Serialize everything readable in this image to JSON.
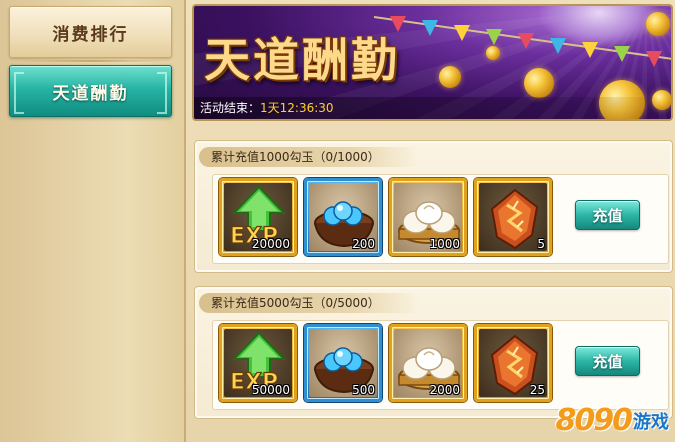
{
  "sidebar": {
    "items": [
      {
        "label": "消费排行",
        "state": "inactive"
      },
      {
        "label": "天道酬勤",
        "state": "active"
      }
    ]
  },
  "banner": {
    "title": "天道酬勤",
    "timer_label": "活动结束：",
    "timer_value": "1天12:36:30"
  },
  "panels": [
    {
      "title": "累计充值1000勾玉（0/1000）",
      "items": [
        {
          "icon": "exp-arrow-icon",
          "count": "20000",
          "frame": "gold"
        },
        {
          "icon": "blue-gem-bowl-icon",
          "count": "200",
          "frame": "blue"
        },
        {
          "icon": "steamed-buns-icon",
          "count": "1000",
          "frame": "gold"
        },
        {
          "icon": "fire-rune-stone-icon",
          "count": "5",
          "frame": "gold"
        }
      ],
      "button_label": "充值"
    },
    {
      "title": "累计充值5000勾玉（0/5000）",
      "items": [
        {
          "icon": "exp-arrow-icon",
          "count": "50000",
          "frame": "gold"
        },
        {
          "icon": "blue-gem-bowl-icon",
          "count": "500",
          "frame": "blue"
        },
        {
          "icon": "steamed-buns-icon",
          "count": "2000",
          "frame": "gold"
        },
        {
          "icon": "fire-rune-stone-icon",
          "count": "25",
          "frame": "gold"
        }
      ],
      "button_label": "充值"
    }
  ],
  "watermark": {
    "number": "8090",
    "word": "游戏"
  },
  "colors": {
    "accent_teal": "#27b4a4",
    "gold_frame": "#e0a21d",
    "blue_frame": "#2f8fcf",
    "timer": "#ffd22a"
  }
}
